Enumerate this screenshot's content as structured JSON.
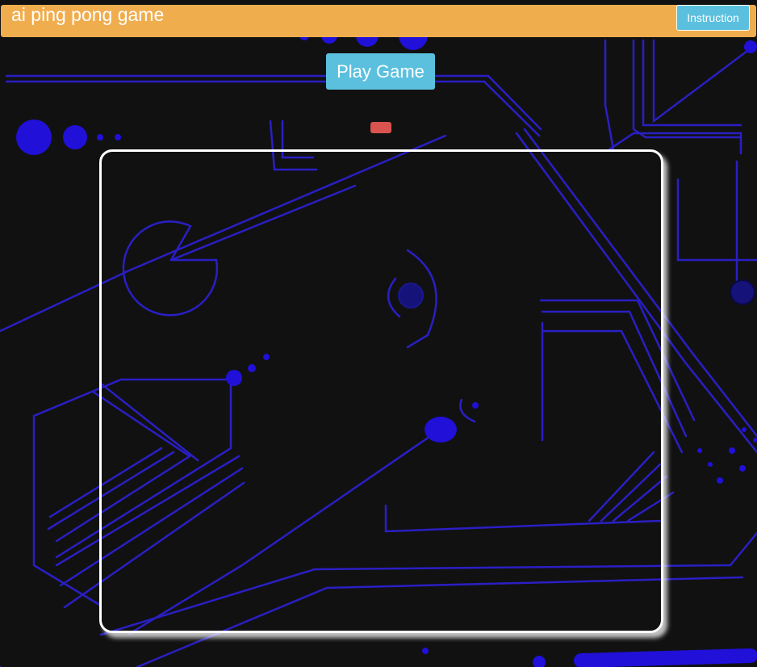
{
  "navbar": {
    "title": "ai ping pong game",
    "instruction_label": "Instruction"
  },
  "main": {
    "play_label": "Play Game"
  },
  "game": {
    "paddle_color": "#d9534f",
    "board_border_color": "#ffffff"
  },
  "colors": {
    "navbar": "#f0ad4e",
    "button": "#5bc0de",
    "background": "#111111",
    "circuit": "#2b1fd6"
  },
  "icons": {
    "background": "circuit-board-background-icon"
  }
}
